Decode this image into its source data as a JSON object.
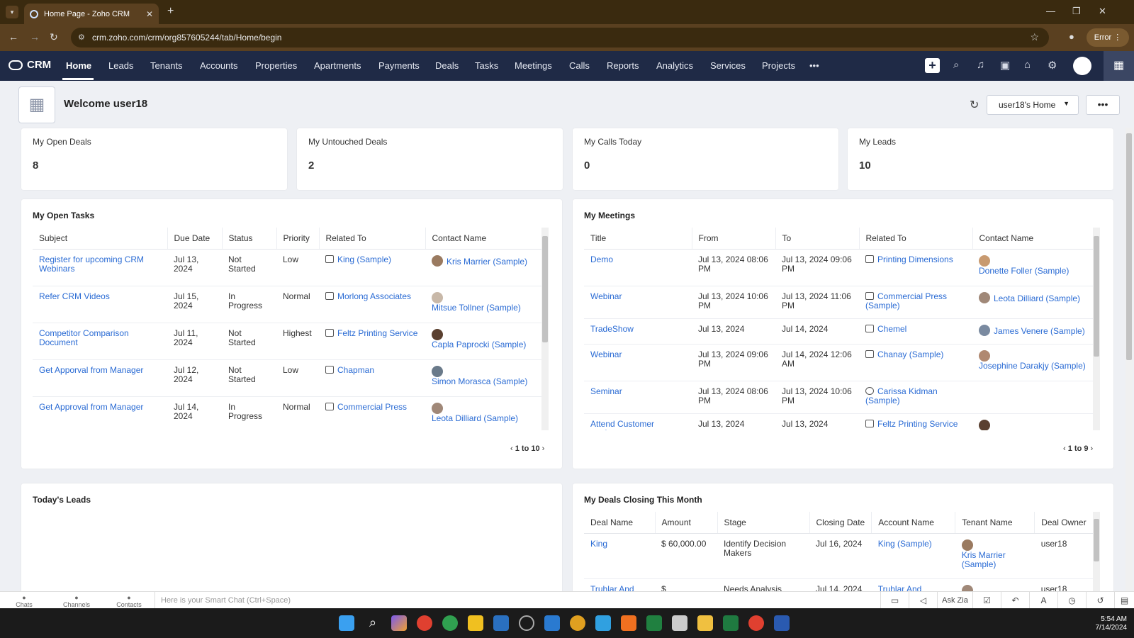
{
  "browser": {
    "tab_title": "Home Page - Zoho CRM",
    "url": "crm.zoho.com/crm/org857605244/tab/Home/begin",
    "error_label": "Error"
  },
  "crm": {
    "logo": "CRM",
    "nav": [
      "Home",
      "Leads",
      "Tenants",
      "Accounts",
      "Properties",
      "Apartments",
      "Payments",
      "Deals",
      "Tasks",
      "Meetings",
      "Calls",
      "Reports",
      "Analytics",
      "Services",
      "Projects"
    ],
    "nav_more": "•••"
  },
  "welcome": {
    "text": "Welcome user18",
    "home_selector": "user18's Home",
    "more": "•••"
  },
  "kpis": [
    {
      "label": "My Open Deals",
      "value": "8"
    },
    {
      "label": "My Untouched Deals",
      "value": "2"
    },
    {
      "label": "My Calls Today",
      "value": "0"
    },
    {
      "label": "My Leads",
      "value": "10"
    }
  ],
  "open_tasks": {
    "title": "My Open Tasks",
    "headers": [
      "Subject",
      "Due Date",
      "Status",
      "Priority",
      "Related To",
      "Contact Name"
    ],
    "rows": [
      [
        "Register for upcoming CRM Webinars",
        "Jul 13, 2024",
        "Not Started",
        "Low",
        "King (Sample)",
        "Kris Marrier (Sample)"
      ],
      [
        "Refer CRM Videos",
        "Jul 15, 2024",
        "In Progress",
        "Normal",
        "Morlong Associates",
        "Mitsue Tollner (Sample)"
      ],
      [
        "Competitor Comparison Document",
        "Jul 11, 2024",
        "Not Started",
        "Highest",
        "Feltz Printing Service",
        "Capla Paprocki (Sample)"
      ],
      [
        "Get Apporval from Manager",
        "Jul 12, 2024",
        "Not Started",
        "Low",
        "Chapman",
        "Simon Morasca (Sample)"
      ],
      [
        "Get Approval from Manager",
        "Jul 14, 2024",
        "In Progress",
        "Normal",
        "Commercial Press",
        "Leota Dilliard (Sample)"
      ]
    ],
    "pager": "1 to 10"
  },
  "meetings": {
    "title": "My Meetings",
    "headers": [
      "Title",
      "From",
      "To",
      "Related To",
      "Contact Name"
    ],
    "rows": [
      [
        "Demo",
        "Jul 13, 2024 08:06 PM",
        "Jul 13, 2024 09:06 PM",
        "Printing Dimensions",
        "Donette Foller (Sample)"
      ],
      [
        "Webinar",
        "Jul 13, 2024 10:06 PM",
        "Jul 13, 2024 11:06 PM",
        "Commercial Press (Sample)",
        "Leota Dilliard (Sample)"
      ],
      [
        "TradeShow",
        "Jul 13, 2024",
        "Jul 14, 2024",
        "Chemel",
        "James Venere (Sample)"
      ],
      [
        "Webinar",
        "Jul 13, 2024 09:06 PM",
        "Jul 14, 2024 12:06 AM",
        "Chanay (Sample)",
        "Josephine Darakjy (Sample)"
      ],
      [
        "Seminar",
        "Jul 13, 2024 08:06 PM",
        "Jul 13, 2024 10:06 PM",
        "Carissa Kidman (Sample)",
        ""
      ],
      [
        "Attend Customer conference",
        "Jul 13, 2024",
        "Jul 13, 2024",
        "Feltz Printing Service",
        ""
      ]
    ],
    "pager": "1 to 9"
  },
  "todays_leads": {
    "title": "Today's Leads"
  },
  "deals_closing": {
    "title": "My Deals Closing This Month",
    "headers": [
      "Deal Name",
      "Amount",
      "Stage",
      "Closing Date",
      "Account Name",
      "Tenant Name",
      "Deal Owner"
    ],
    "rows": [
      [
        "King",
        "$ 60,000.00",
        "Identify Decision Makers",
        "Jul 16, 2024",
        "King (Sample)",
        "Kris Marrier (Sample)",
        "user18"
      ],
      [
        "Truhlar And",
        "$",
        "Needs Analysis",
        "Jul 14, 2024",
        "Truhlar And",
        "",
        "user18"
      ]
    ]
  },
  "smartchat": {
    "chats": "Chats",
    "channels": "Channels",
    "contacts": "Contacts",
    "placeholder": "Here is your Smart Chat (Ctrl+Space)",
    "ask_zia": "Ask Zia"
  },
  "taskbar": {
    "time": "5:54 AM",
    "date": "7/14/2024"
  }
}
